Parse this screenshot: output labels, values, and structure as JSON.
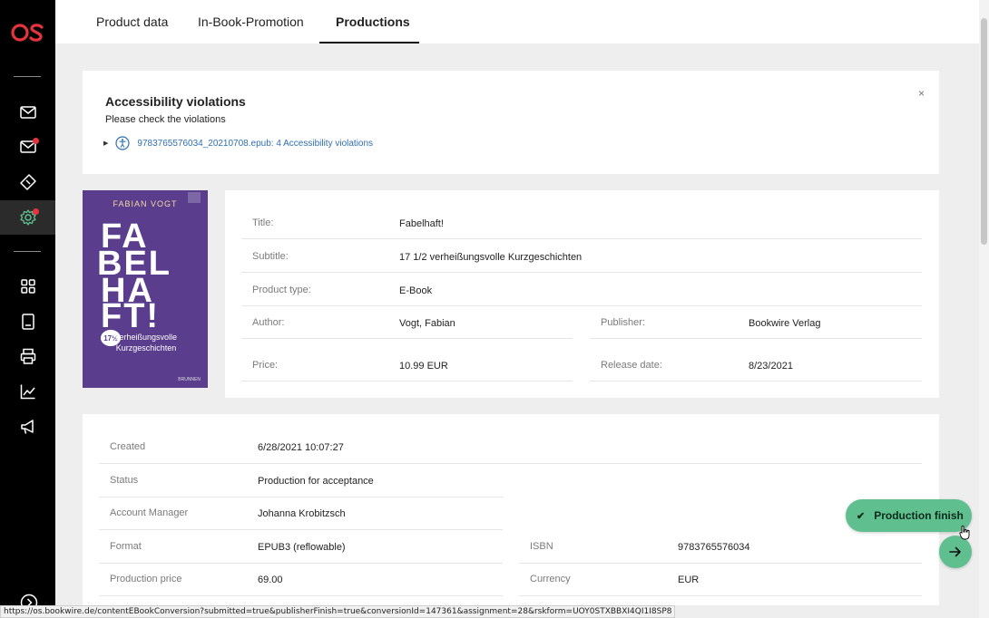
{
  "app": {
    "logo_text": "OS"
  },
  "tabs": [
    {
      "label": "Product data"
    },
    {
      "label": "In-Book-Promotion"
    },
    {
      "label": "Productions"
    }
  ],
  "accessibility": {
    "title": "Accessibility violations",
    "subtitle": "Please check the violations",
    "violation_link": "9783765576034_20210708.epub: 4 Accessibility violations",
    "close": "×"
  },
  "cover": {
    "author": "FABIAN VOGT",
    "lines": [
      "FA",
      "BEL",
      "HA",
      "FT!"
    ],
    "badge": "17½",
    "subtitle_lines": [
      "verheißungsvolle",
      "Kurzgeschichten"
    ],
    "publisher_mark": "BRUNNEN"
  },
  "product": {
    "title_label": "Title:",
    "title": "Fabelhaft!",
    "subtitle_label": "Subtitle:",
    "subtitle": "17 1/2 verheißungsvolle Kurzgeschichten",
    "type_label": "Product type:",
    "type": "E-Book",
    "author_label": "Author:",
    "author": "Vogt, Fabian",
    "publisher_label": "Publisher:",
    "publisher": "Bookwire Verlag",
    "price_label": "Price:",
    "price": "10.99 EUR",
    "release_label": "Release date:",
    "release": "8/23/2021"
  },
  "production": {
    "created_label": "Created",
    "created": "6/28/2021 10:07:27",
    "status_label": "Status",
    "status": "Production for acceptance",
    "manager_label": "Account Manager",
    "manager": "Johanna Krobitzsch",
    "format_label": "Format",
    "format": "EPUB3 (reflowable)",
    "isbn_label": "ISBN",
    "isbn": "9783765576034",
    "price_label": "Production price",
    "price": "69.00",
    "currency_label": "Currency",
    "currency": "EUR"
  },
  "actions": {
    "finish_label": "Production finish"
  },
  "status_url": "https://os.bookwire.de/contentEBookConversion?submitted=true&publisherFinish=true&conversionId=147361&assignment=28&rskform=UOY0STXBBXI4QI1I8SP8",
  "colors": {
    "accent": "#5fbf8f",
    "logo": "#e5343d",
    "link": "#2f6fb3"
  }
}
